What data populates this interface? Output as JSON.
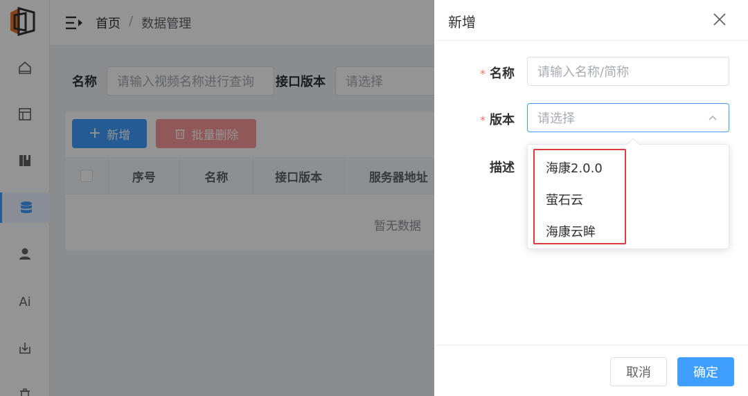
{
  "header": {
    "breadcrumb": {
      "home": "首页",
      "separator": "/",
      "current": "数据管理"
    }
  },
  "sidebar": {
    "items": [
      {
        "icon": "home-icon"
      },
      {
        "icon": "layout-icon"
      },
      {
        "icon": "book-icon"
      },
      {
        "icon": "database-icon",
        "active": true
      },
      {
        "icon": "user-icon"
      },
      {
        "icon": "ai-icon",
        "text": "Ai"
      },
      {
        "icon": "download-icon"
      },
      {
        "icon": "trash-icon"
      }
    ]
  },
  "filters": {
    "name_label": "名称",
    "name_placeholder": "请输入视频名称进行查询",
    "version_label": "接口版本",
    "version_placeholder": "请选择"
  },
  "toolbar": {
    "add_label": "新增",
    "batch_delete_label": "批量删除"
  },
  "table": {
    "columns": [
      "序号",
      "名称",
      "接口版本",
      "服务器地址"
    ],
    "empty_text": "暂无数据"
  },
  "drawer": {
    "title": "新增",
    "required_mark": "*",
    "name_label": "名称",
    "name_placeholder": "请输入名称/简称",
    "version_label": "版本",
    "version_placeholder": "请选择",
    "description_label": "描述",
    "version_options": [
      "海康2.0.0",
      "萤石云",
      "海康云眸"
    ],
    "cancel_label": "取消",
    "confirm_label": "确定"
  },
  "colors": {
    "primary": "#409eff",
    "danger_disabled": "#f89898",
    "required": "#f56c6c",
    "highlight": "#e03b3b"
  }
}
